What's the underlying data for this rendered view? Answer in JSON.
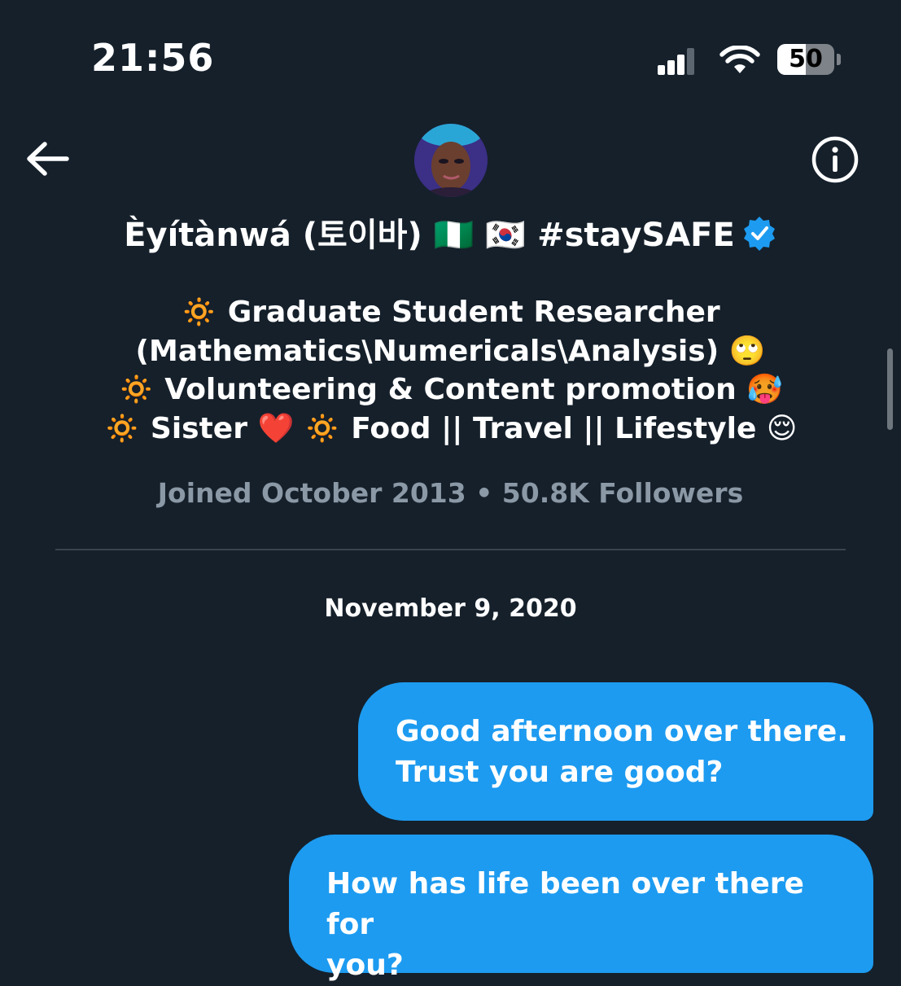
{
  "status_bar": {
    "time": "21:56",
    "battery_level": "50",
    "battery_fraction": 0.5,
    "signal_bars_active": 3,
    "signal_bars_total": 4
  },
  "header": {
    "back_icon": "arrow-left-icon",
    "info_icon": "info-circle-icon",
    "avatar_icon": "profile-avatar",
    "display_name": "Èyítànwá (토이바) 🇳🇬 🇰🇷 #staySAFE",
    "verified_icon": "verified-badge-icon"
  },
  "bio": {
    "lines": [
      "🔅 Graduate Student Researcher",
      "(Mathematics\\Numericals\\Analysis) 🙄",
      "🔅 Volunteering & Content promotion 🥵",
      "🔅 Sister ❤️  🔅 Food || Travel || Lifestyle 😌"
    ]
  },
  "meta": {
    "joined_followers": "Joined October 2013 • 50.8K Followers"
  },
  "conversation": {
    "date_separator": "November 9, 2020",
    "messages": [
      {
        "sender": "me",
        "lines": [
          "Good afternoon over there.",
          "Trust you are good?"
        ]
      },
      {
        "sender": "me",
        "lines": [
          "How has life been over there for",
          "you?"
        ]
      }
    ]
  },
  "colors": {
    "background": "#15202b",
    "bubble": "#1d9bf0",
    "muted_text": "#8b98a5",
    "divider": "#38444d",
    "verified": "#1d9bf0"
  }
}
